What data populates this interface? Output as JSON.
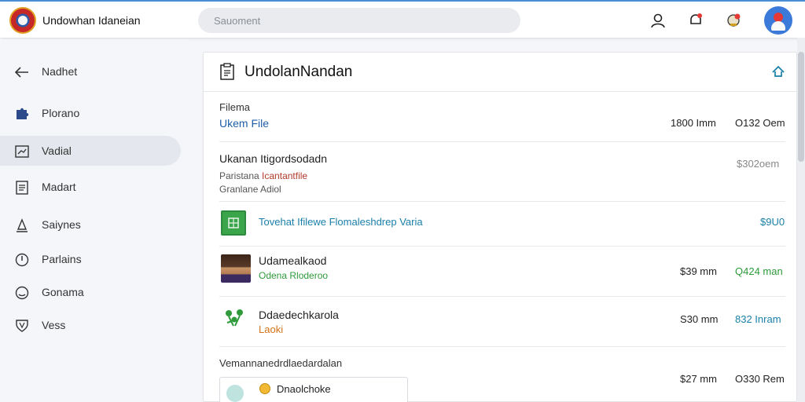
{
  "header": {
    "app_title": "Undowhan Idaneian",
    "search_placeholder": "Sauoment"
  },
  "sidebar": {
    "items": [
      {
        "label": "Nadhet",
        "icon": "arrow-left-icon",
        "active": false
      },
      {
        "label": "Plorano",
        "icon": "puzzle-icon",
        "active": false
      },
      {
        "label": "Vadial",
        "icon": "chart-box-icon",
        "active": true
      },
      {
        "label": "Madart",
        "icon": "document-icon",
        "active": false
      },
      {
        "label": "Saiynes",
        "icon": "person-icon",
        "active": false
      },
      {
        "label": "Parlains",
        "icon": "info-icon",
        "active": false
      },
      {
        "label": "Gonama",
        "icon": "face-icon",
        "active": false
      },
      {
        "label": "Vess",
        "icon": "shield-icon",
        "active": false
      }
    ]
  },
  "card": {
    "title": "UndolanNandan",
    "rows": [
      {
        "label": "Filema",
        "link": "Ukem File",
        "size": "1800 Imm",
        "amount": "O132 Oem"
      },
      {
        "title": "Ukanan Itigordsodadn",
        "sub1_prefix": "Paristana",
        "sub1_link": "Icantantfile",
        "sub2": "Granlane Adiol",
        "amount": "$302oem"
      },
      {
        "link": "Tovehat Ifilewe Flomaleshdrep Varia",
        "amount": "$9U0"
      },
      {
        "title": "Udamealkaod",
        "sub": "Odena Rloderoo",
        "size": "$39 mm",
        "amount": "Q424 man"
      },
      {
        "title": "Ddaedechkarola",
        "sub": "Laoki",
        "size": "S30 mm",
        "amount": "832 Inram"
      },
      {
        "title": "Vemannanedrdlaedardalan",
        "box_label": "Dnaolchoke",
        "size": "$27 mm",
        "amount": "O330 Rem"
      }
    ]
  },
  "colors": {
    "accent_blue": "#1f5fa8",
    "link_teal": "#1a7fa8",
    "green": "#2e9a3a",
    "orange": "#d4741a",
    "red_link": "#b23a2a"
  }
}
